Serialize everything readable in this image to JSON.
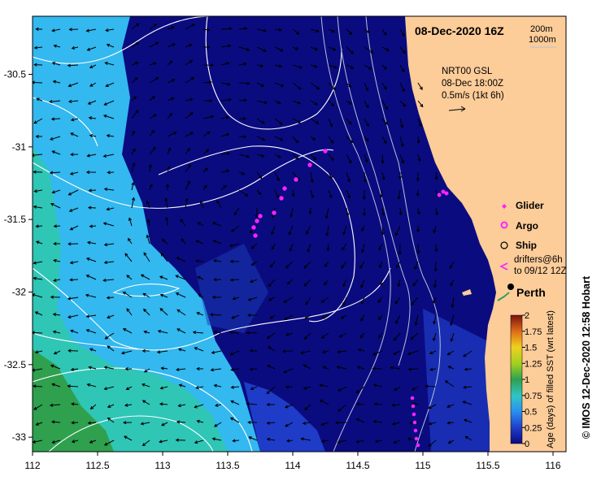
{
  "map": {
    "title": "08-Dec-2020 16Z",
    "depth_contours": [
      "200m",
      "1000m"
    ],
    "current_info": [
      "NRT00 GSL",
      "08-Dec 18:00Z",
      "0.5m/s (1kt 6h)"
    ],
    "city": "Perth",
    "credit": "© IMOS 12-Dec-2020 12:58 Hobart",
    "x_ticks": [
      "112",
      "112.5",
      "113",
      "113.5",
      "114",
      "114.5",
      "115",
      "115.5",
      "116"
    ],
    "y_ticks": [
      "-30.5",
      "-31",
      "-31.5",
      "-32",
      "-32.5",
      "-33"
    ],
    "x_range": [
      112,
      116.1
    ],
    "y_range": [
      -33.1,
      -30.1
    ],
    "legend": {
      "glider": "Glider",
      "argo": "Argo",
      "ship": "Ship",
      "drifters_line1": "drifters@6h",
      "drifters_line2": "to 09/12 12Z"
    },
    "colorbar": {
      "title": "Age (days) of filled SST (wrt latest)",
      "ticks": [
        "2",
        "1.75",
        "1.5",
        "1.25",
        "1",
        "0.75",
        "0.5",
        "0.25",
        "0"
      ],
      "range": [
        0,
        2
      ]
    },
    "colors": {
      "land": "#fccc99",
      "deep_blue": "#0b0b80",
      "mid_blue": "#1f3cc8",
      "cyan": "#33b8f0",
      "teal": "#2fc6b6",
      "green": "#2fa04e",
      "magenta": "#ff22ff"
    }
  }
}
